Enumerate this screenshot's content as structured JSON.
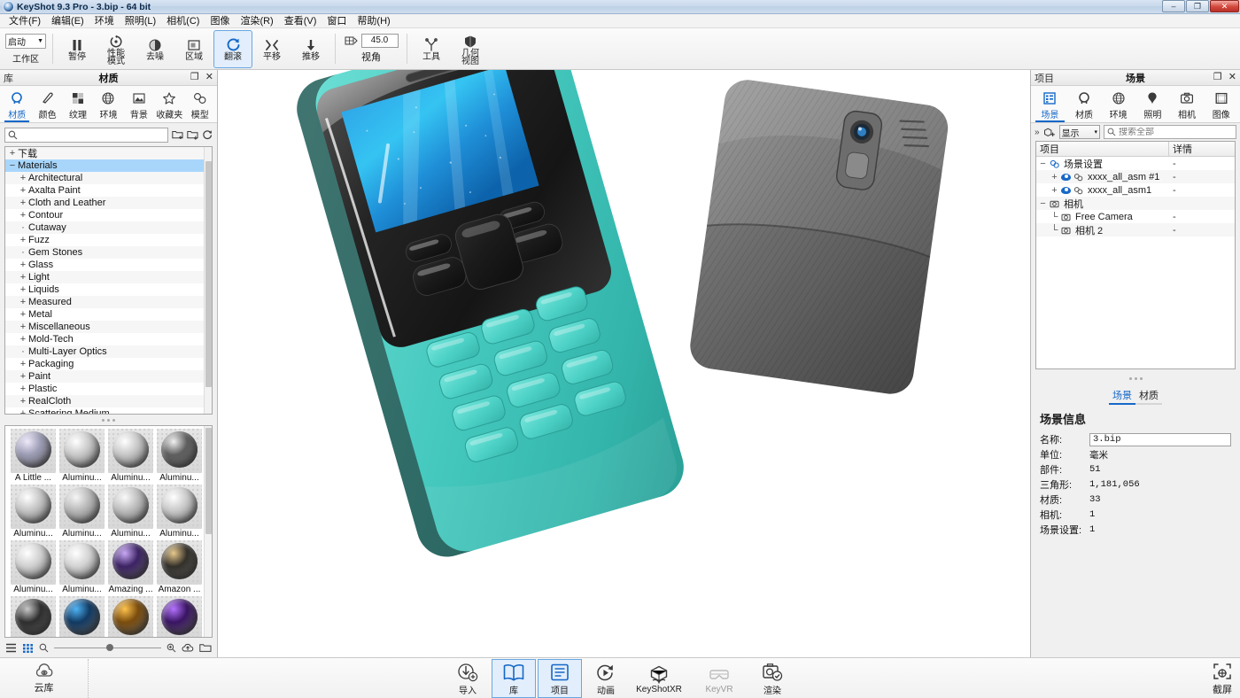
{
  "window": {
    "title": "KeyShot 9.3 Pro  - 3.bip  - 64 bit",
    "minimize": "–",
    "maximize": "❐",
    "close": "✕"
  },
  "menubar": {
    "items": [
      {
        "label": "文件(F)"
      },
      {
        "label": "编辑(E)"
      },
      {
        "label": "环境"
      },
      {
        "label": "照明(L)"
      },
      {
        "label": "相机(C)"
      },
      {
        "label": "图像"
      },
      {
        "label": "渲染(R)"
      },
      {
        "label": "查看(V)"
      },
      {
        "label": "窗口"
      },
      {
        "label": "帮助(H)"
      }
    ]
  },
  "toolbar": {
    "workspace": {
      "value": "启动",
      "label": "工作区"
    },
    "items": [
      {
        "label": "暂停",
        "icon": "pause-icon",
        "active": false
      },
      {
        "label": "性能\n模式",
        "icon": "performance-mode-icon",
        "active": false
      },
      {
        "label": "去噪",
        "icon": "denoise-icon",
        "active": false
      },
      {
        "label": "区域",
        "icon": "region-icon",
        "active": false
      },
      {
        "label": "翻滚",
        "icon": "tumble-icon",
        "active": true
      },
      {
        "label": "平移",
        "icon": "pan-icon",
        "active": false
      },
      {
        "label": "推移",
        "icon": "dolly-icon",
        "active": false
      }
    ],
    "angle": {
      "value": "45.0",
      "label": "视角",
      "icon": "view-angle-icon"
    },
    "tools": {
      "label": "工具",
      "icon": "tools-icon"
    },
    "geometry": {
      "label": "几何\n视图",
      "icon": "geometry-view-icon"
    }
  },
  "library": {
    "header": {
      "left": "库",
      "title": "材质",
      "undock": "❐",
      "close": "✕"
    },
    "tabs": [
      {
        "label": "材质",
        "icon": "material-ball-icon",
        "selected": true
      },
      {
        "label": "颜色",
        "icon": "color-drop-icon",
        "selected": false
      },
      {
        "label": "纹理",
        "icon": "texture-grid-icon",
        "selected": false
      },
      {
        "label": "环境",
        "icon": "environment-globe-icon",
        "selected": false
      },
      {
        "label": "背景",
        "icon": "background-image-icon",
        "selected": false
      },
      {
        "label": "收藏夹",
        "icon": "favorites-star-icon",
        "selected": false
      },
      {
        "label": "模型",
        "icon": "model-icon",
        "selected": false
      }
    ],
    "search": {
      "placeholder": "",
      "value": "",
      "icon": "search-icon"
    },
    "search_buttons": [
      {
        "icon": "add-folder-icon"
      },
      {
        "icon": "import-folder-icon"
      },
      {
        "icon": "refresh-icon"
      }
    ],
    "tree": [
      {
        "label": "下载",
        "expander": "+",
        "level": 1,
        "selected": false
      },
      {
        "label": "Materials",
        "expander": "−",
        "level": 1,
        "selected": true
      },
      {
        "label": "Architectural",
        "expander": "+",
        "level": 2,
        "selected": false
      },
      {
        "label": "Axalta Paint",
        "expander": "+",
        "level": 2,
        "selected": false
      },
      {
        "label": "Cloth and Leather",
        "expander": "+",
        "level": 2,
        "selected": false
      },
      {
        "label": "Contour",
        "expander": "+",
        "level": 2,
        "selected": false
      },
      {
        "label": "Cutaway",
        "expander": "·",
        "level": 2,
        "selected": false
      },
      {
        "label": "Fuzz",
        "expander": "+",
        "level": 2,
        "selected": false
      },
      {
        "label": "Gem Stones",
        "expander": "·",
        "level": 2,
        "selected": false
      },
      {
        "label": "Glass",
        "expander": "+",
        "level": 2,
        "selected": false
      },
      {
        "label": "Light",
        "expander": "+",
        "level": 2,
        "selected": false
      },
      {
        "label": "Liquids",
        "expander": "+",
        "level": 2,
        "selected": false
      },
      {
        "label": "Measured",
        "expander": "+",
        "level": 2,
        "selected": false
      },
      {
        "label": "Metal",
        "expander": "+",
        "level": 2,
        "selected": false
      },
      {
        "label": "Miscellaneous",
        "expander": "+",
        "level": 2,
        "selected": false
      },
      {
        "label": "Mold-Tech",
        "expander": "+",
        "level": 2,
        "selected": false
      },
      {
        "label": "Multi-Layer Optics",
        "expander": "·",
        "level": 2,
        "selected": false
      },
      {
        "label": "Packaging",
        "expander": "+",
        "level": 2,
        "selected": false
      },
      {
        "label": "Paint",
        "expander": "+",
        "level": 2,
        "selected": false
      },
      {
        "label": "Plastic",
        "expander": "+",
        "level": 2,
        "selected": false
      },
      {
        "label": "RealCloth",
        "expander": "+",
        "level": 2,
        "selected": false
      },
      {
        "label": "Scattering Medium",
        "expander": "+",
        "level": 2,
        "selected": false
      }
    ],
    "materials": [
      {
        "label": "A Little ...",
        "color": "#9b9bb4",
        "hi": "#efeafb"
      },
      {
        "label": "Aluminu...",
        "color": "#c8c8c8",
        "hi": "#ffffff"
      },
      {
        "label": "Aluminu...",
        "color": "#c6c6c6",
        "hi": "#ffffff"
      },
      {
        "label": "Aluminu...",
        "color": "#5e5e5e",
        "hi": "#f2f2f2"
      },
      {
        "label": "Aluminu...",
        "color": "#c4c4c4",
        "hi": "#ffffff"
      },
      {
        "label": "Aluminu...",
        "color": "#b8b8b8",
        "hi": "#f6f6f6"
      },
      {
        "label": "Aluminu...",
        "color": "#bdbdbd",
        "hi": "#fafafa"
      },
      {
        "label": "Aluminu...",
        "color": "#c9c9c9",
        "hi": "#ffffff"
      },
      {
        "label": "Aluminu...",
        "color": "#cfcfcf",
        "hi": "#ffffff"
      },
      {
        "label": "Aluminu...",
        "color": "#d2d2d2",
        "hi": "#ffffff"
      },
      {
        "label": "Amazing ...",
        "color": "#3c2364",
        "hi": "#c9a9f5"
      },
      {
        "label": "Amazon ...",
        "color": "#33302a",
        "hi": "#e8c98c"
      },
      {
        "label": "",
        "color": "#2e2e2e",
        "hi": "#c9c9c9"
      },
      {
        "label": "",
        "color": "#123a63",
        "hi": "#4fb4f5"
      },
      {
        "label": "",
        "color": "#7a4c0d",
        "hi": "#ffc34d"
      },
      {
        "label": "",
        "color": "#3a1563",
        "hi": "#b473ff"
      }
    ],
    "footer": {
      "list_view_icon": "list-view-icon",
      "grid_view_icon": "grid-view-icon",
      "zoom_out_icon": "zoom-out-icon",
      "zoom_in_icon": "zoom-in-icon",
      "cloud_icon": "cloud-upload-icon",
      "folder_icon": "open-folder-icon",
      "slider_value": 52
    }
  },
  "project": {
    "header": {
      "left": "项目",
      "title": "场景",
      "undock": "❐",
      "close": "✕"
    },
    "tabs": [
      {
        "label": "场景",
        "icon": "scene-tree-icon",
        "selected": true
      },
      {
        "label": "材质",
        "icon": "material-ball-icon",
        "selected": false
      },
      {
        "label": "环境",
        "icon": "environment-globe-icon",
        "selected": false
      },
      {
        "label": "照明",
        "icon": "lighting-bulb-icon",
        "selected": false
      },
      {
        "label": "相机",
        "icon": "camera-icon",
        "selected": false
      },
      {
        "label": "图像",
        "icon": "image-frame-icon",
        "selected": false
      }
    ],
    "toolrow": {
      "collapse_icon": "chevron-right-icon",
      "add_model_icon": "add-model-icon",
      "display_label": "显示",
      "display_chevron": "▾",
      "search_placeholder": "搜索全部",
      "search_icon": "search-icon"
    },
    "scene_tree": {
      "columns": [
        "项目",
        "详情"
      ],
      "rows": [
        {
          "indent": 0,
          "expander": "−",
          "eye": false,
          "icon": "scene-set-icon",
          "label": "场景设置",
          "detail": "-"
        },
        {
          "indent": 1,
          "expander": "+",
          "eye": true,
          "icon": "model-group-icon",
          "label": "xxxx_all_asm #1",
          "detail": "-"
        },
        {
          "indent": 1,
          "expander": "+",
          "eye": true,
          "icon": "model-group-icon",
          "label": "xxxx_all_asm1",
          "detail": "-"
        },
        {
          "indent": 0,
          "expander": "−",
          "eye": false,
          "icon": "camera-icon",
          "label": "相机",
          "detail": ""
        },
        {
          "indent": 1,
          "expander": "└",
          "eye": false,
          "icon": "camera-icon",
          "label": "Free Camera",
          "detail": "-"
        },
        {
          "indent": 1,
          "expander": "└",
          "eye": false,
          "icon": "camera-icon",
          "label": "相机 2",
          "detail": "-"
        }
      ]
    },
    "sub_tabs": [
      {
        "label": "场景",
        "selected": true
      },
      {
        "label": "材质",
        "selected": false
      }
    ],
    "scene_info": {
      "title": "场景信息",
      "name_label": "名称:",
      "name_value": "3.bip",
      "fields": [
        {
          "key": "单位:",
          "value": "毫米"
        },
        {
          "key": "部件:",
          "value": "51"
        },
        {
          "key": "三角形:",
          "value": "1,181,056"
        },
        {
          "key": "材质:",
          "value": "33"
        },
        {
          "key": "相机:",
          "value": "1"
        },
        {
          "key": "场景设置:",
          "value": "1"
        }
      ]
    }
  },
  "bottombar": {
    "cloud": {
      "label": "云库",
      "icon": "cloud-library-icon"
    },
    "items": [
      {
        "label": "导入",
        "icon": "import-icon",
        "selected": false,
        "dim": false,
        "wide": false
      },
      {
        "label": "库",
        "icon": "library-book-icon",
        "selected": true,
        "dim": false,
        "wide": false
      },
      {
        "label": "项目",
        "icon": "project-list-icon",
        "selected": true,
        "dim": false,
        "wide": false
      },
      {
        "label": "动画",
        "icon": "animation-icon",
        "selected": false,
        "dim": false,
        "wide": false
      },
      {
        "label": "KeyShotXR",
        "icon": "keyshotxr-icon",
        "selected": false,
        "dim": false,
        "wide": true
      },
      {
        "label": "KeyVR",
        "icon": "keyvr-icon",
        "selected": false,
        "dim": true,
        "wide": true
      },
      {
        "label": "渲染",
        "icon": "render-icon",
        "selected": false,
        "dim": false,
        "wide": false
      }
    ],
    "screenshot": {
      "label": "截屏",
      "icon": "screenshot-icon"
    }
  },
  "viewport": {
    "render_description": "两部手机渲染图：前方青绿色直板手机正面，后方灰色手机背面",
    "background": "#ffffff",
    "phone_front_color": "#4ecdc4",
    "phone_back_color": "#7a7a7a",
    "screen_color": "#1aa3e8"
  },
  "colors": {
    "accent": "#1668c8",
    "selection": "#a8d6fb",
    "panel_bg": "#f0f0f0",
    "titlebar": "#c9d9ec"
  }
}
